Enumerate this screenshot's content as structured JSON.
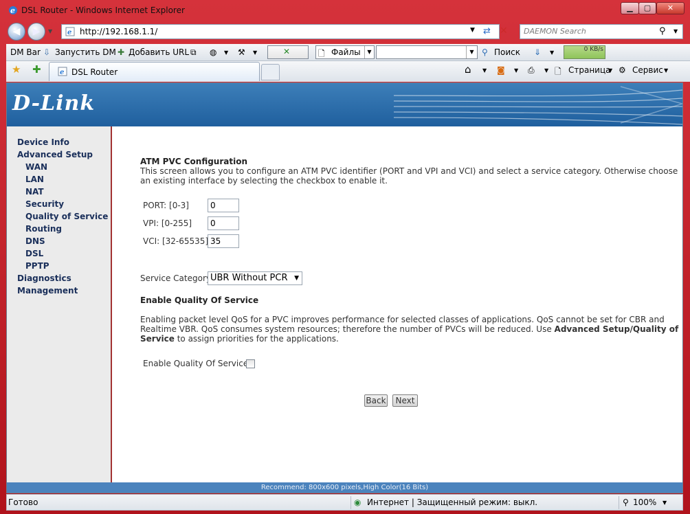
{
  "window": {
    "title": "DSL Router - Windows Internet Explorer",
    "min": "▁",
    "max": "▢",
    "close": "✕"
  },
  "address": {
    "url": "http://192.168.1.1/"
  },
  "search": {
    "placeholder": "DAEMON Search"
  },
  "toolbar": {
    "dmbar": "DM Bar",
    "launch_dm": "Запустить DM",
    "add_url": "Добавить URL",
    "files": "Файлы",
    "find": "Поиск",
    "speed": "0 KB/s"
  },
  "tabs": [
    {
      "label": "DSL Router"
    }
  ],
  "command_bar": {
    "page": "Страница",
    "tools": "Сервис"
  },
  "banner": {
    "logo": "D-Link"
  },
  "sidebar": {
    "items": [
      {
        "label": "Device Info"
      },
      {
        "label": "Advanced Setup"
      },
      {
        "label": "WAN"
      },
      {
        "label": "LAN"
      },
      {
        "label": "NAT"
      },
      {
        "label": "Security"
      },
      {
        "label": "Quality of Service"
      },
      {
        "label": "Routing"
      },
      {
        "label": "DNS"
      },
      {
        "label": "DSL"
      },
      {
        "label": "PPTP"
      },
      {
        "label": "Diagnostics"
      },
      {
        "label": "Management"
      }
    ]
  },
  "main": {
    "heading": "ATM PVC Configuration",
    "intro_line1": "This screen allows you to configure an ATM PVC identifier (PORT and VPI and VCI) and select a service category. Otherwise choose",
    "intro_line2": "an existing interface by selecting the checkbox to enable it.",
    "port_label": "PORT: [0-3]",
    "port_value": "0",
    "vpi_label": "VPI: [0-255]",
    "vpi_value": "0",
    "vci_label": "VCI: [32-65535]",
    "vci_value": "35",
    "service_category_label": "Service Category:",
    "service_category_value": "UBR Without PCR",
    "qos_heading": "Enable Quality Of Service",
    "qos_line1": "Enabling packet level QoS for a PVC improves performance for selected classes of applications.  QoS cannot be set for CBR and",
    "qos_line2_a": "Realtime VBR.  QoS consumes system resources; therefore the number of PVCs will be reduced. Use ",
    "qos_line2_b": "Advanced Setup/Quality of",
    "qos_line3_a": "Service",
    "qos_line3_b": " to assign priorities for the applications.",
    "qos_checkbox_label": "Enable Quality Of Service",
    "back": "Back",
    "next": "Next"
  },
  "footer": {
    "text": "Recommend: 800x600 pixels,High Color(16 Bits)"
  },
  "status": {
    "left": "Готово",
    "zone": "Интернет | Защищенный режим: выкл.",
    "zoom": "100%"
  }
}
